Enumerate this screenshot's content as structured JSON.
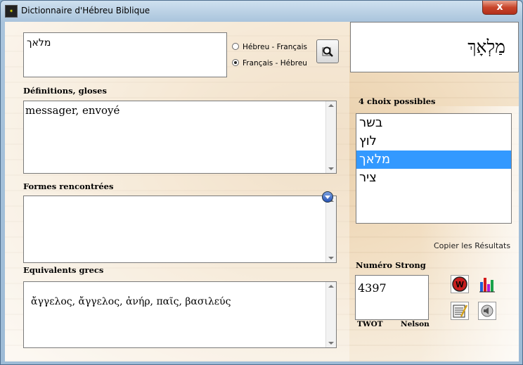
{
  "window": {
    "title": "Dictionnaire d'Hébreu Biblique",
    "close_glyph": "x"
  },
  "search": {
    "value": "מלאך"
  },
  "direction": {
    "options": [
      {
        "label": "Hébreu - Français",
        "selected": false
      },
      {
        "label": "Français - Hébreu",
        "selected": true
      }
    ]
  },
  "display_word": "מַלְאָךְ",
  "definitions": {
    "label": "Définitions, gloses",
    "value": "messager, envoyé"
  },
  "forms": {
    "label": "Formes rencontrées",
    "value": ""
  },
  "greek": {
    "label": "Equivalents grecs",
    "value": "ἄγγελος, ἄγγελος, ἀνήρ, παῖς, βασιλεύς"
  },
  "choices": {
    "label": "4 choix possibles",
    "items": [
      "בשר",
      "לוץ",
      "מלאך",
      "ציר"
    ],
    "selected_index": 2
  },
  "copy_results": "Copier les Résultats",
  "strong": {
    "label": "Numéro Strong",
    "value": "4397",
    "twot_label": "TWOT",
    "nelson_label": "Nelson"
  },
  "colors": {
    "selection": "#3399ff",
    "close": "#c8452b"
  }
}
